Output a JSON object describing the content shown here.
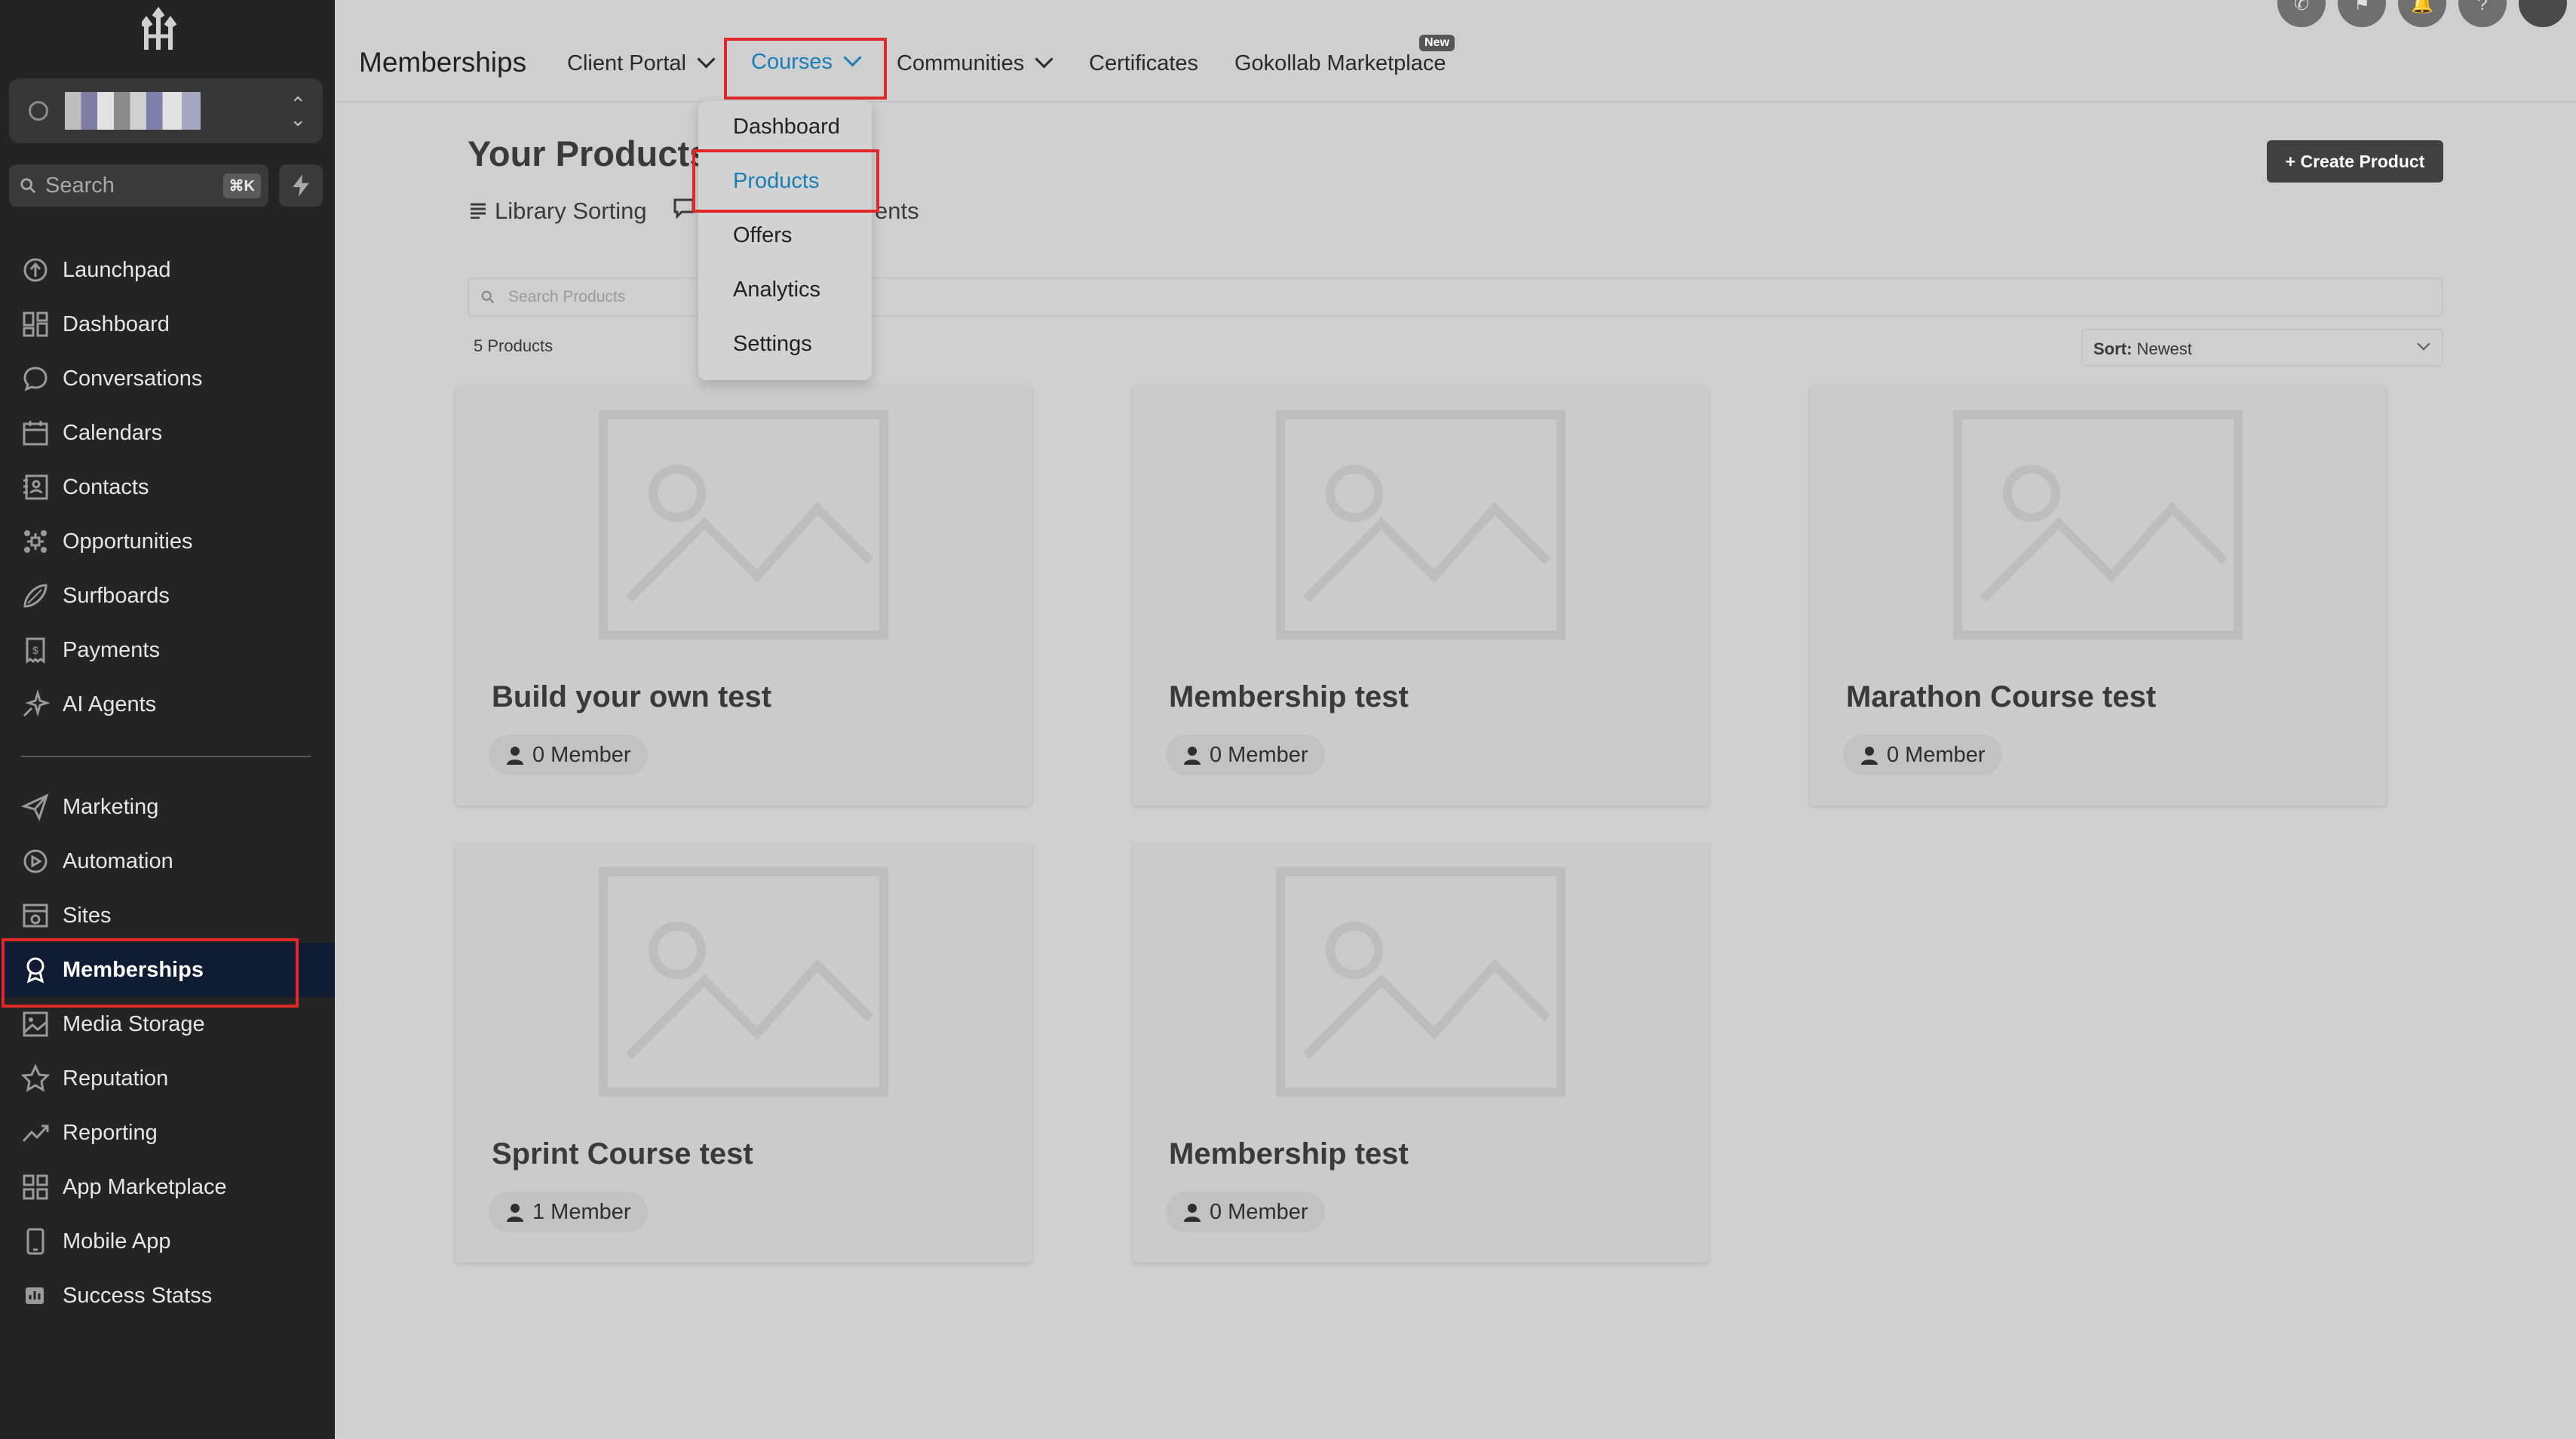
{
  "sidebar": {
    "search_placeholder": "Search",
    "search_shortcut": "⌘K",
    "items": [
      {
        "label": "Launchpad",
        "icon": "launchpad-icon"
      },
      {
        "label": "Dashboard",
        "icon": "dashboard-grid-icon"
      },
      {
        "label": "Conversations",
        "icon": "chat-bubble-icon"
      },
      {
        "label": "Calendars",
        "icon": "calendar-icon"
      },
      {
        "label": "Contacts",
        "icon": "contacts-icon"
      },
      {
        "label": "Opportunities",
        "icon": "opportunities-icon"
      },
      {
        "label": "Surfboards",
        "icon": "surfboard-icon"
      },
      {
        "label": "Payments",
        "icon": "payments-icon"
      },
      {
        "label": "AI Agents",
        "icon": "ai-sparkle-icon"
      },
      {
        "label": "Marketing",
        "icon": "send-icon"
      },
      {
        "label": "Automation",
        "icon": "automation-icon"
      },
      {
        "label": "Sites",
        "icon": "sites-icon"
      },
      {
        "label": "Memberships",
        "icon": "membership-badge-icon",
        "active": true
      },
      {
        "label": "Media Storage",
        "icon": "image-icon"
      },
      {
        "label": "Reputation",
        "icon": "star-icon"
      },
      {
        "label": "Reporting",
        "icon": "trend-icon"
      },
      {
        "label": "App Marketplace",
        "icon": "apps-grid-icon"
      },
      {
        "label": "Mobile App",
        "icon": "mobile-icon"
      },
      {
        "label": "Success Statss",
        "icon": "stats-icon"
      }
    ]
  },
  "topbar": {
    "title": "Memberships",
    "nav": [
      {
        "label": "Client Portal",
        "has_caret": true
      },
      {
        "label": "Courses",
        "has_caret": true,
        "active": true
      },
      {
        "label": "Communities",
        "has_caret": true
      },
      {
        "label": "Certificates"
      },
      {
        "label": "Gokollab Marketplace",
        "badge": "New"
      }
    ]
  },
  "dropdown": {
    "items": [
      "Dashboard",
      "Products",
      "Offers",
      "Analytics",
      "Settings"
    ],
    "selected": "Products"
  },
  "main": {
    "heading": "Your Products",
    "tabs": [
      "Library Sorting",
      "ents"
    ],
    "create_button": "+ Create Product",
    "search_placeholder": "Search Products",
    "count": "5 Products",
    "sort_label": "Sort:",
    "sort_value": "Newest",
    "products": [
      {
        "title": "Build your own test",
        "members": "0 Member"
      },
      {
        "title": "Membership test",
        "members": "0 Member"
      },
      {
        "title": "Marathon Course test",
        "members": "0 Member"
      },
      {
        "title": "Sprint Course test",
        "members": "1 Member"
      },
      {
        "title": "Membership test",
        "members": "0 Member"
      }
    ]
  },
  "colors": {
    "sidebar_bg": "#242424",
    "active_item_bg": "#101c33",
    "accent_blue": "#1a7fb8",
    "highlight_red": "#e0282a"
  }
}
